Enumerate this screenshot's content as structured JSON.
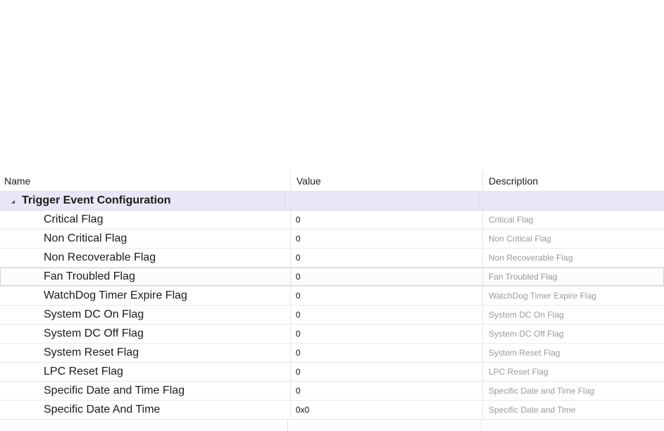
{
  "columns": {
    "name": "Name",
    "value": "Value",
    "description": "Description"
  },
  "category": {
    "title": "Trigger Event Configuration"
  },
  "rows": [
    {
      "name": "Critical Flag",
      "value": "0",
      "description": "Critical Flag"
    },
    {
      "name": "Non Critical Flag",
      "value": "0",
      "description": "Non Critical Flag"
    },
    {
      "name": "Non Recoverable Flag",
      "value": "0",
      "description": "Non Recoverable Flag"
    },
    {
      "name": "Fan Troubled Flag",
      "value": "0",
      "description": "Fan Troubled Flag"
    },
    {
      "name": "WatchDog Timer Expire Flag",
      "value": "0",
      "description": "WatchDog Timer Expire Flag"
    },
    {
      "name": "System DC On Flag",
      "value": "0",
      "description": "System DC On Flag"
    },
    {
      "name": "System DC Off Flag",
      "value": "0",
      "description": "System DC Off Flag"
    },
    {
      "name": "System Reset Flag",
      "value": "0",
      "description": "System Reset Flag"
    },
    {
      "name": "LPC Reset Flag",
      "value": "0",
      "description": "LPC Reset Flag"
    },
    {
      "name": "Specific Date and Time Flag",
      "value": "0",
      "description": "Specific Date and Time Flag"
    },
    {
      "name": "Specific Date And Time",
      "value": "0x0",
      "description": "Specific Date and Time"
    }
  ],
  "colors": {
    "category_bg": "#e7e7f7",
    "description_text": "#9a9a9a"
  },
  "icons": {
    "expand": "collapse-triangle-icon"
  }
}
